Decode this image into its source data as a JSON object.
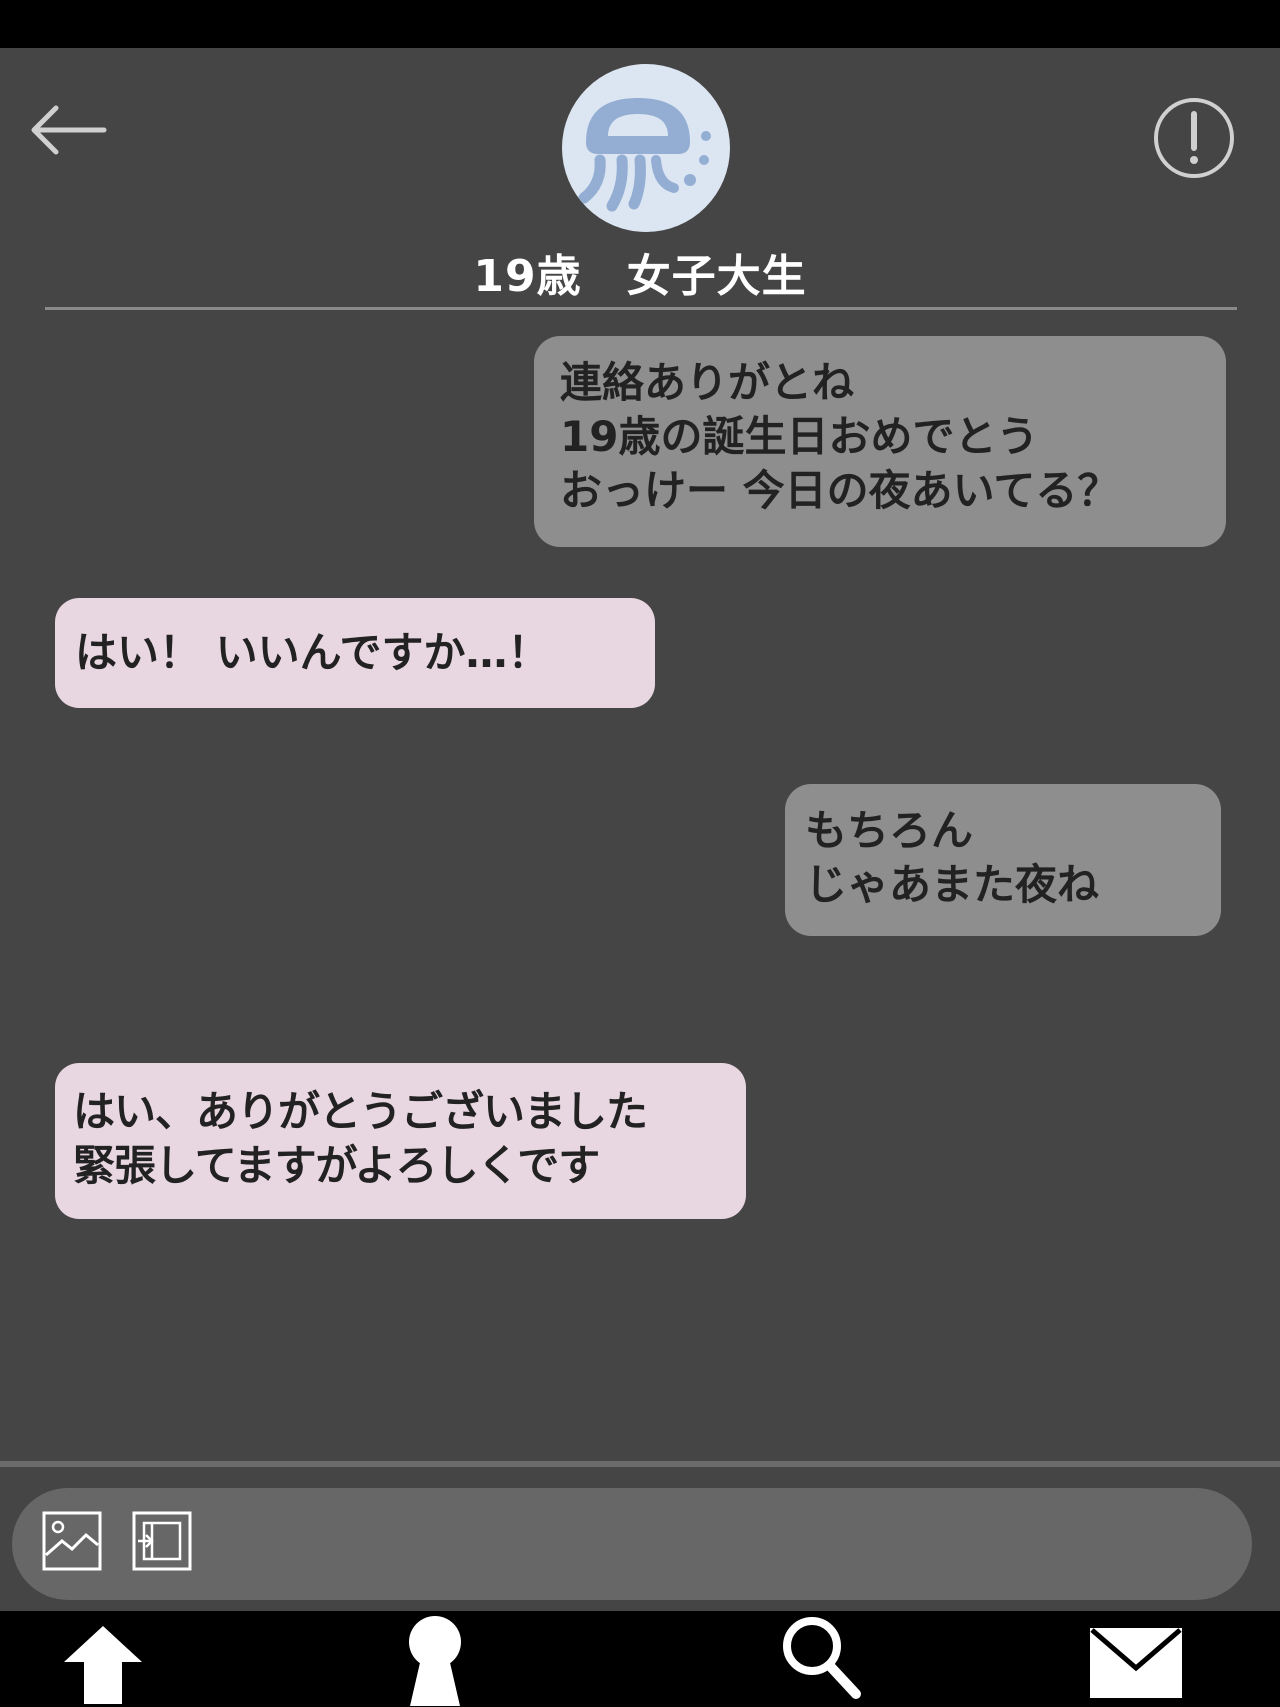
{
  "header": {
    "contact_name": "19歳　女子大生",
    "back_icon": "back-arrow-icon",
    "info_icon": "exclamation-circle-icon",
    "avatar_icon": "jellyfish-icon"
  },
  "messages": [
    {
      "direction": "sent",
      "text": "連絡ありがとね\n19歳の誕生日おめでとう\nおっけー 今日の夜あいてる？"
    },
    {
      "direction": "received",
      "text": "はい！ いいんですか…！"
    },
    {
      "direction": "sent",
      "text": "もちろん\nじゃあまた夜ね"
    },
    {
      "direction": "received",
      "text": "はい、ありがとうございました\n緊張してますがよろしくです"
    }
  ],
  "composer": {
    "icons": [
      "image-icon",
      "attach-file-icon"
    ]
  },
  "bottom_nav": {
    "items": [
      "home-arrow-icon",
      "keyhole-icon",
      "search-icon",
      "mail-icon"
    ]
  },
  "colors": {
    "background": "#454545",
    "sent_bubble": "#8e8e8e",
    "received_bubble": "#e8d6e0",
    "composer": "#676767",
    "avatar_bg": "#dce6f3",
    "jellyfish": "#93aed2"
  }
}
